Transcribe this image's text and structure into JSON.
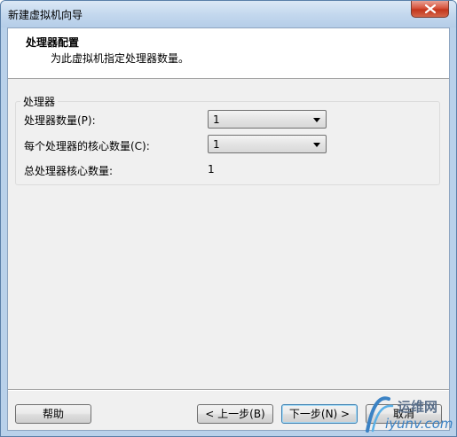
{
  "window": {
    "title": "新建虚拟机向导"
  },
  "header": {
    "title": "处理器配置",
    "subtitle": "为此虚拟机指定处理器数量。"
  },
  "processor_group": {
    "label": "处理器",
    "processor_count_label": "处理器数量(P):",
    "processor_count_value": "1",
    "cores_per_processor_label": "每个处理器的核心数量(C):",
    "cores_per_processor_value": "1",
    "total_cores_label": "总处理器核心数量:",
    "total_cores_value": "1"
  },
  "buttons": {
    "help": "帮助",
    "back": "< 上一步(B)",
    "next": "下一步(N) >",
    "cancel": "取消"
  },
  "watermark": {
    "top_text": "运维网",
    "bottom_text": "iyunv.com"
  },
  "colors": {
    "titlebar": "#c4d8ee",
    "close_button": "#c3361c",
    "dialog_background": "#f0f0f0"
  },
  "icons": {
    "close": "close-icon",
    "dropdown": "chevron-down-icon",
    "watermark_logo": "logo-icon"
  }
}
